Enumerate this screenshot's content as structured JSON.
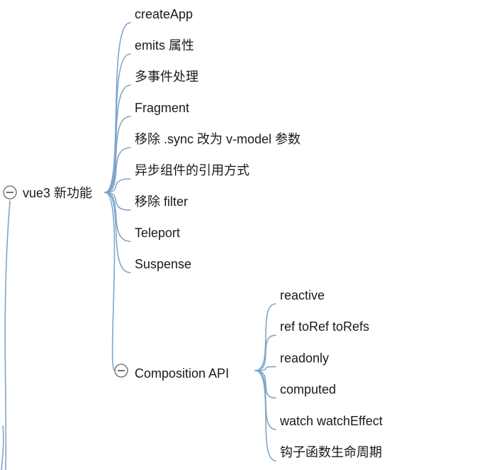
{
  "nodes": {
    "vue3": "vue3 新功能",
    "composition": "Composition API"
  },
  "vue3_children": [
    "createApp",
    "emits 属性",
    "多事件处理",
    "Fragment",
    "移除 .sync 改为 v-model 参数",
    "异步组件的引用方式",
    "移除 filter",
    "Teleport",
    "Suspense"
  ],
  "composition_children": [
    "reactive",
    "ref toRef toRefs",
    "readonly",
    "computed",
    "watch watchEffect",
    "钩子函数生命周期"
  ],
  "colors": {
    "branch": "#7fa6c9",
    "text": "#1a1a1a",
    "toggle": "#666666"
  },
  "icons": {
    "collapse": "minus-circle-icon"
  }
}
